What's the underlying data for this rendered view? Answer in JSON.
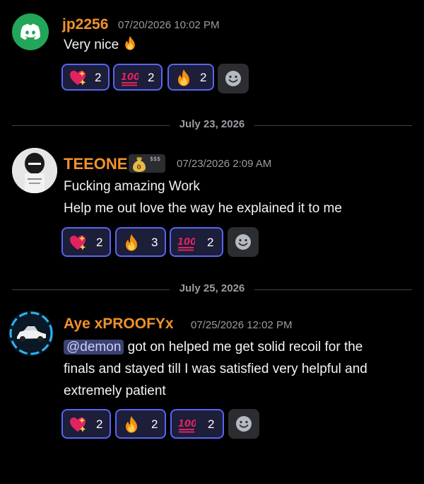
{
  "messages": [
    {
      "author": "jp2256",
      "timestamp": "07/20/2026 10:02 PM",
      "content": "Very nice",
      "reactions": [
        {
          "emoji": "sparkling-heart",
          "count": "2"
        },
        {
          "emoji": "hundred-points",
          "count": "2"
        },
        {
          "emoji": "fire",
          "count": "2"
        }
      ]
    },
    {
      "author": "TEEONE",
      "timestamp": "07/23/2026 2:09 AM",
      "badge_text": "$$$",
      "content_lines": [
        "Fucking amazing Work",
        "Help me out love the way he explained it to me"
      ],
      "reactions": [
        {
          "emoji": "sparkling-heart",
          "count": "2"
        },
        {
          "emoji": "fire",
          "count": "3"
        },
        {
          "emoji": "hundred-points",
          "count": "2"
        }
      ]
    },
    {
      "author": "Aye xPROOFYx",
      "timestamp": "07/25/2026 12:02 PM",
      "mention": "@demon",
      "content_line1": " got on helped me get solid recoil for the",
      "content_line2": "finals and stayed till I was satisfied very helpful and",
      "content_line3": "extremely patient",
      "reactions": [
        {
          "emoji": "sparkling-heart",
          "count": "2"
        },
        {
          "emoji": "fire",
          "count": "2"
        },
        {
          "emoji": "hundred-points",
          "count": "2"
        }
      ]
    }
  ],
  "dividers": [
    "July 23, 2026",
    "July 25, 2026"
  ],
  "colors": {
    "background": "#000000",
    "author": "#f0922b",
    "timestamp": "#9b9ca3",
    "reaction_border": "#5865f2",
    "mention_bg": "#3c4270",
    "discord_blurple": "#23a55a"
  }
}
